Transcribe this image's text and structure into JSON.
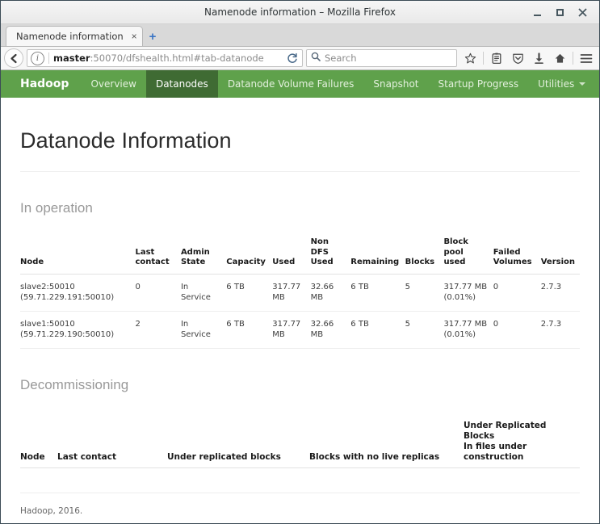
{
  "window": {
    "title": "Namenode information – Mozilla Firefox",
    "minimize_label": "Minimize",
    "maximize_label": "Maximize",
    "close_label": "Close"
  },
  "browser": {
    "tab": {
      "title": "Namenode information",
      "close_label": "×"
    },
    "new_tab_label": "+",
    "back_label": "Back",
    "url": {
      "host": "master",
      "path": ":50070/dfshealth.html#tab-datanode",
      "full": "master:50070/dfshealth.html#tab-datanode"
    },
    "identity_icon_label": "i",
    "reload_label": "Reload",
    "search": {
      "placeholder": "Search"
    },
    "toolbar_icons": [
      {
        "name": "bookmark-star-icon",
        "label": "Bookmark this page"
      },
      {
        "name": "library-icon",
        "label": "Show your library"
      },
      {
        "name": "pocket-icon",
        "label": "Save to Pocket"
      },
      {
        "name": "downloads-icon",
        "label": "Downloads"
      },
      {
        "name": "home-icon",
        "label": "Home"
      },
      {
        "name": "menu-icon",
        "label": "Open menu"
      }
    ]
  },
  "hadoop": {
    "brand": "Hadoop",
    "nav": [
      {
        "label": "Overview",
        "active": false
      },
      {
        "label": "Datanodes",
        "active": true
      },
      {
        "label": "Datanode Volume Failures",
        "active": false
      },
      {
        "label": "Snapshot",
        "active": false
      },
      {
        "label": "Startup Progress",
        "active": false
      },
      {
        "label": "Utilities",
        "active": false,
        "dropdown": true
      }
    ],
    "page_title": "Datanode Information",
    "in_operation": {
      "heading": "In operation",
      "columns": [
        "Node",
        "Last\ncontact",
        "Admin\nState",
        "Capacity",
        "Used",
        "Non\nDFS\nUsed",
        "Remaining",
        "Blocks",
        "Block\npool\nused",
        "Failed\nVolumes",
        "Version"
      ],
      "rows": [
        {
          "node": "slave2:50010\n(59.71.229.191:50010)",
          "last_contact": "0",
          "admin_state": "In\nService",
          "capacity": "6 TB",
          "used": "317.77\nMB",
          "non_dfs_used": "32.66\nMB",
          "remaining": "6 TB",
          "blocks": "5",
          "block_pool_used": "317.77 MB\n(0.01%)",
          "failed_volumes": "0",
          "version": "2.7.3"
        },
        {
          "node": "slave1:50010\n(59.71.229.190:50010)",
          "last_contact": "2",
          "admin_state": "In\nService",
          "capacity": "6 TB",
          "used": "317.77\nMB",
          "non_dfs_used": "32.66\nMB",
          "remaining": "6 TB",
          "blocks": "5",
          "block_pool_used": "317.77 MB\n(0.01%)",
          "failed_volumes": "0",
          "version": "2.7.3"
        }
      ]
    },
    "decommissioning": {
      "heading": "Decommissioning",
      "columns": [
        "Node",
        "Last contact",
        "Under replicated blocks",
        "Blocks with no live replicas",
        "Under Replicated Blocks\nIn files under construction"
      ],
      "rows": []
    },
    "footer": "Hadoop, 2016."
  },
  "colors": {
    "brand_green": "#5fa14b",
    "active_green": "#3f6b33",
    "nav_text": "#e3f0dd"
  }
}
